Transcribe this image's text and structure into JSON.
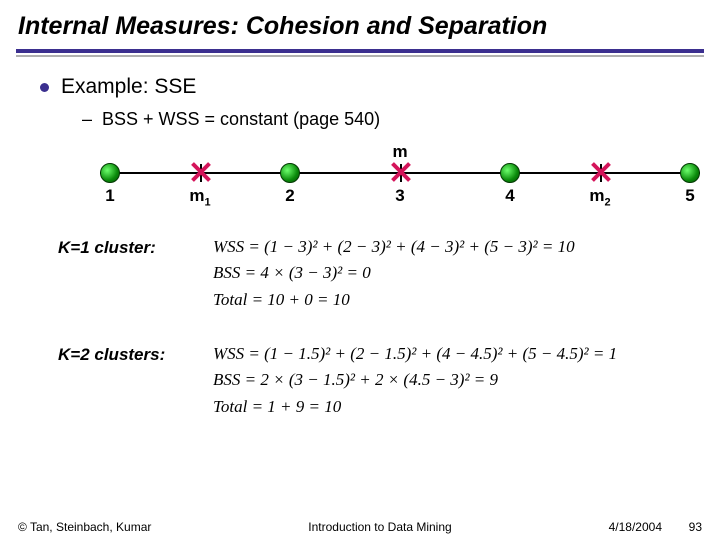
{
  "title": "Internal Measures: Cohesion and Separation",
  "bullet": "Example: SSE",
  "sub": "BSS + WSS = constant (page 540)",
  "diagram": {
    "m": "m",
    "p1": "1",
    "m1": "m",
    "m1_sub": "1",
    "p2": "2",
    "p3": "3",
    "p4": "4",
    "m2": "m",
    "m2_sub": "2",
    "p5": "5"
  },
  "k1": {
    "label": "K=1 cluster:",
    "wss": "WSS = (1 − 3)² + (2 − 3)² + (4 − 3)² + (5 − 3)² = 10",
    "bss": "BSS = 4 × (3 − 3)² = 0",
    "total": "Total = 10 + 0 = 10"
  },
  "k2": {
    "label": "K=2 clusters:",
    "wss": "WSS = (1 − 1.5)² + (2 − 1.5)² + (4 − 4.5)² + (5 − 4.5)² = 1",
    "bss": "BSS = 2 × (3 − 1.5)² + 2 × (4.5 − 3)² = 9",
    "total": "Total = 1 + 9 = 10"
  },
  "footer": {
    "left": "© Tan, Steinbach, Kumar",
    "mid": "Introduction to Data Mining",
    "date": "4/18/2004",
    "page": "93"
  }
}
